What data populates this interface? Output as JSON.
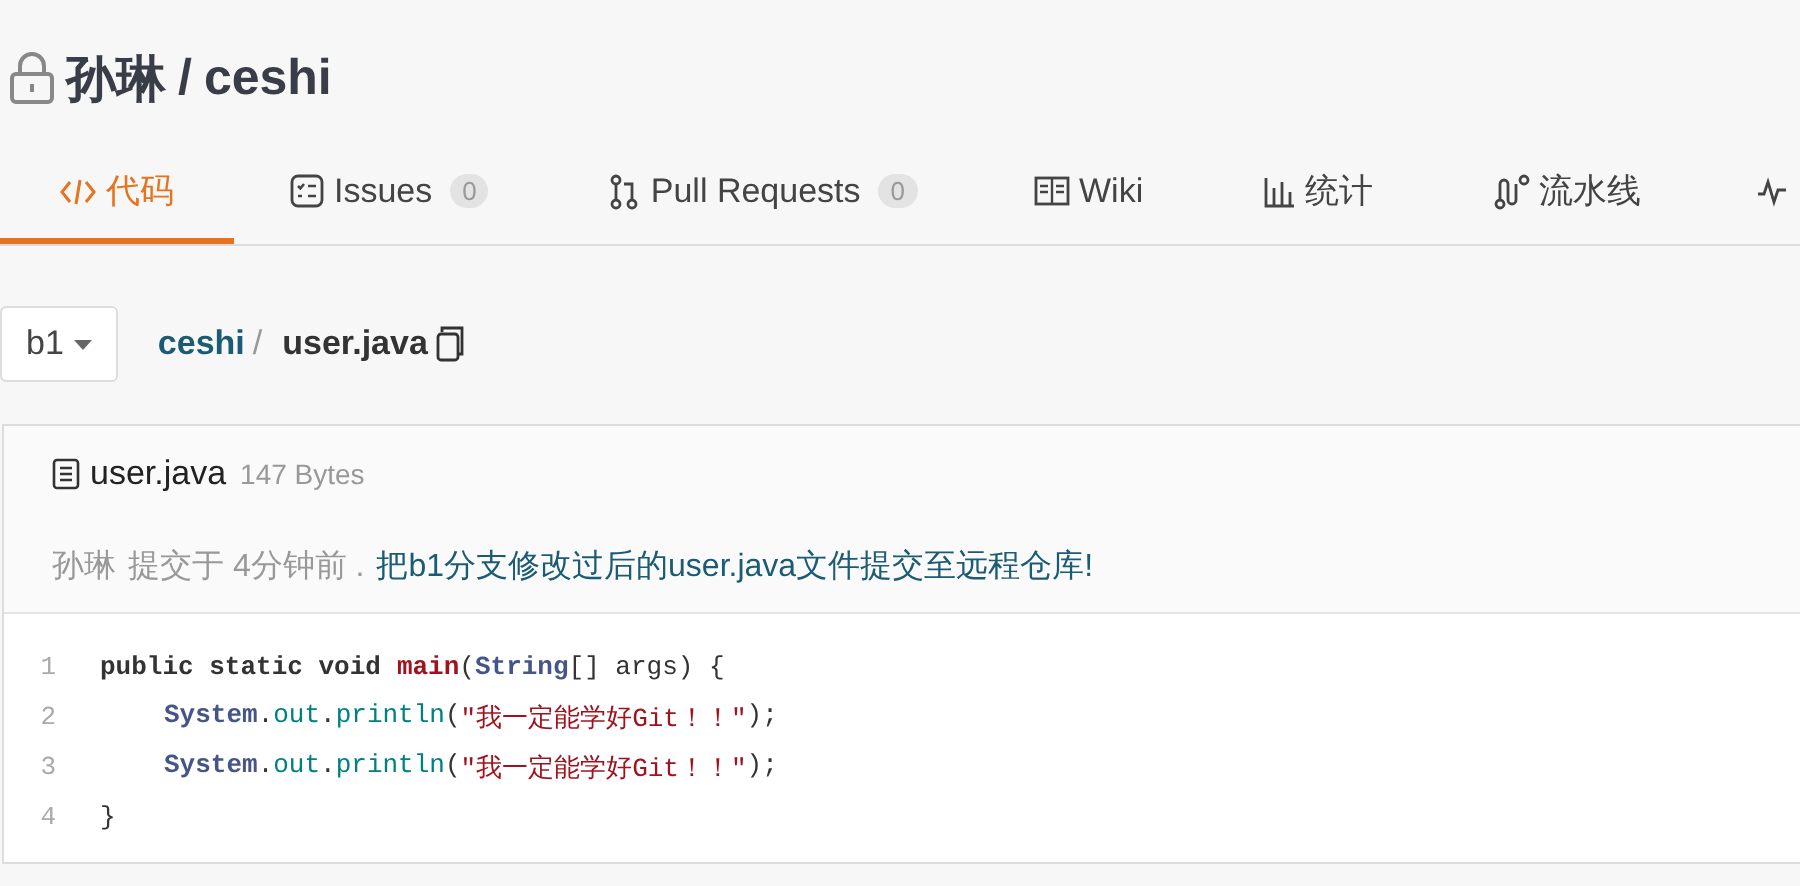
{
  "repo": {
    "owner": "孙琳",
    "separator": "/",
    "name": "ceshi",
    "private": true
  },
  "tabs": [
    {
      "kind": "code",
      "label": "代码",
      "selected": true
    },
    {
      "kind": "issues",
      "label": "Issues",
      "count": "0",
      "selected": false
    },
    {
      "kind": "pull",
      "label": "Pull Requests",
      "count": "0",
      "selected": false
    },
    {
      "kind": "wiki",
      "label": "Wiki",
      "selected": false
    },
    {
      "kind": "stats",
      "label": "统计",
      "selected": false
    },
    {
      "kind": "pipeline",
      "label": "流水线",
      "selected": false
    },
    {
      "kind": "activity",
      "selected": false
    }
  ],
  "branch": "b1",
  "breadcrumb": {
    "repo": "ceshi",
    "separator": "/",
    "file": "user.java"
  },
  "file": {
    "name": "user.java",
    "size": "147 Bytes",
    "author": "孙琳",
    "committed": "提交于 4分钟前 .",
    "message": "把b1分支修改过后的user.java文件提交至远程仓库!"
  },
  "code_lines": [
    {
      "number": "1",
      "indented": false,
      "tokens": [
        {
          "kind": "keyword",
          "text": "public static void"
        },
        {
          "kind": "function",
          "text": "main"
        },
        {
          "kind": "plain",
          "text": "("
        },
        {
          "kind": "type",
          "text": "String"
        },
        {
          "kind": "plain",
          "text": "[] args) {"
        }
      ]
    },
    {
      "number": "2",
      "indented": true,
      "tokens": [
        {
          "kind": "type",
          "text": "System"
        },
        {
          "kind": "plain",
          "text": "."
        },
        {
          "kind": "member",
          "text": "out"
        },
        {
          "kind": "plain",
          "text": "."
        },
        {
          "kind": "member",
          "text": "println"
        },
        {
          "kind": "plain",
          "text": "("
        },
        {
          "kind": "string",
          "text": "\"我一定能学好Git！！\""
        },
        {
          "kind": "plain",
          "text": ");"
        }
      ]
    },
    {
      "number": "3",
      "indented": true,
      "tokens": [
        {
          "kind": "type",
          "text": "System"
        },
        {
          "kind": "plain",
          "text": "."
        },
        {
          "kind": "member",
          "text": "out"
        },
        {
          "kind": "plain",
          "text": "."
        },
        {
          "kind": "member",
          "text": "println"
        },
        {
          "kind": "plain",
          "text": "("
        },
        {
          "kind": "string",
          "text": "\"我一定能学好Git！！\""
        },
        {
          "kind": "plain",
          "text": ");"
        }
      ]
    },
    {
      "number": "4",
      "indented": false,
      "tokens": [
        {
          "kind": "plain",
          "text": "}"
        }
      ]
    }
  ]
}
